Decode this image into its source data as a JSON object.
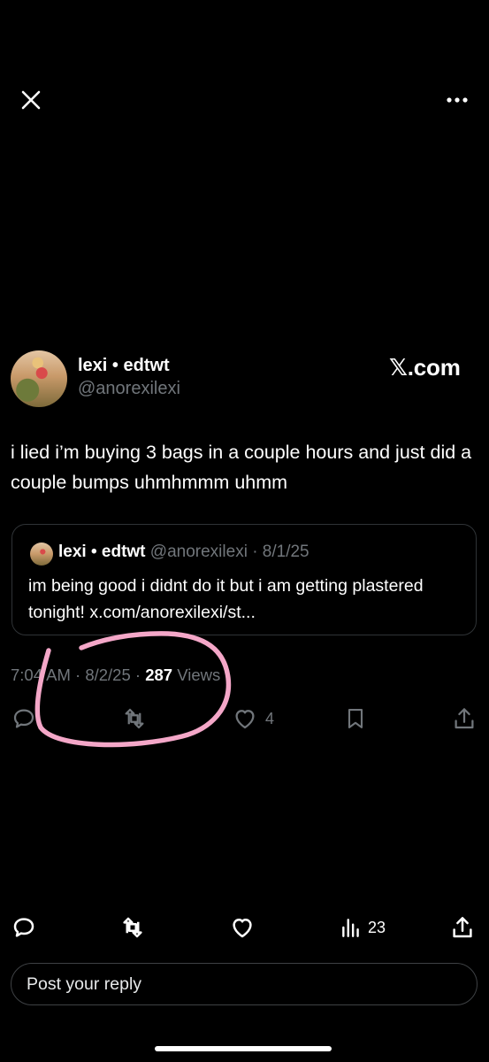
{
  "header": {
    "close_icon": "close-icon",
    "more_icon": "more-horizontal-icon"
  },
  "author": {
    "display_name": "lexi • edtwt",
    "handle": "@anorexilexi"
  },
  "brand": {
    "label": "𝕏.com"
  },
  "tweet": {
    "text": "i lied i’m buying 3 bags in a couple hours and just did a couple bumps uhmhmmm uhmm"
  },
  "quote": {
    "display_name": "lexi • edtwt",
    "handle_date": "@anorexilexi · 8/1/25",
    "text": "im being good i didnt do it but i am getting plastered tonight! x.com/anorexilexi/st..."
  },
  "meta": {
    "time_date": "7:04 AM · 8/2/25 · ",
    "views_count": "287",
    "views_label": " Views"
  },
  "actions": {
    "likes": "4"
  },
  "bottom_bar": {
    "views": "23"
  },
  "reply": {
    "placeholder": "Post your reply"
  },
  "colors": {
    "background": "#000000",
    "text": "#e7e9ea",
    "muted": "#71767b",
    "border": "#2f3336",
    "annotation": "#f4a7c8"
  }
}
